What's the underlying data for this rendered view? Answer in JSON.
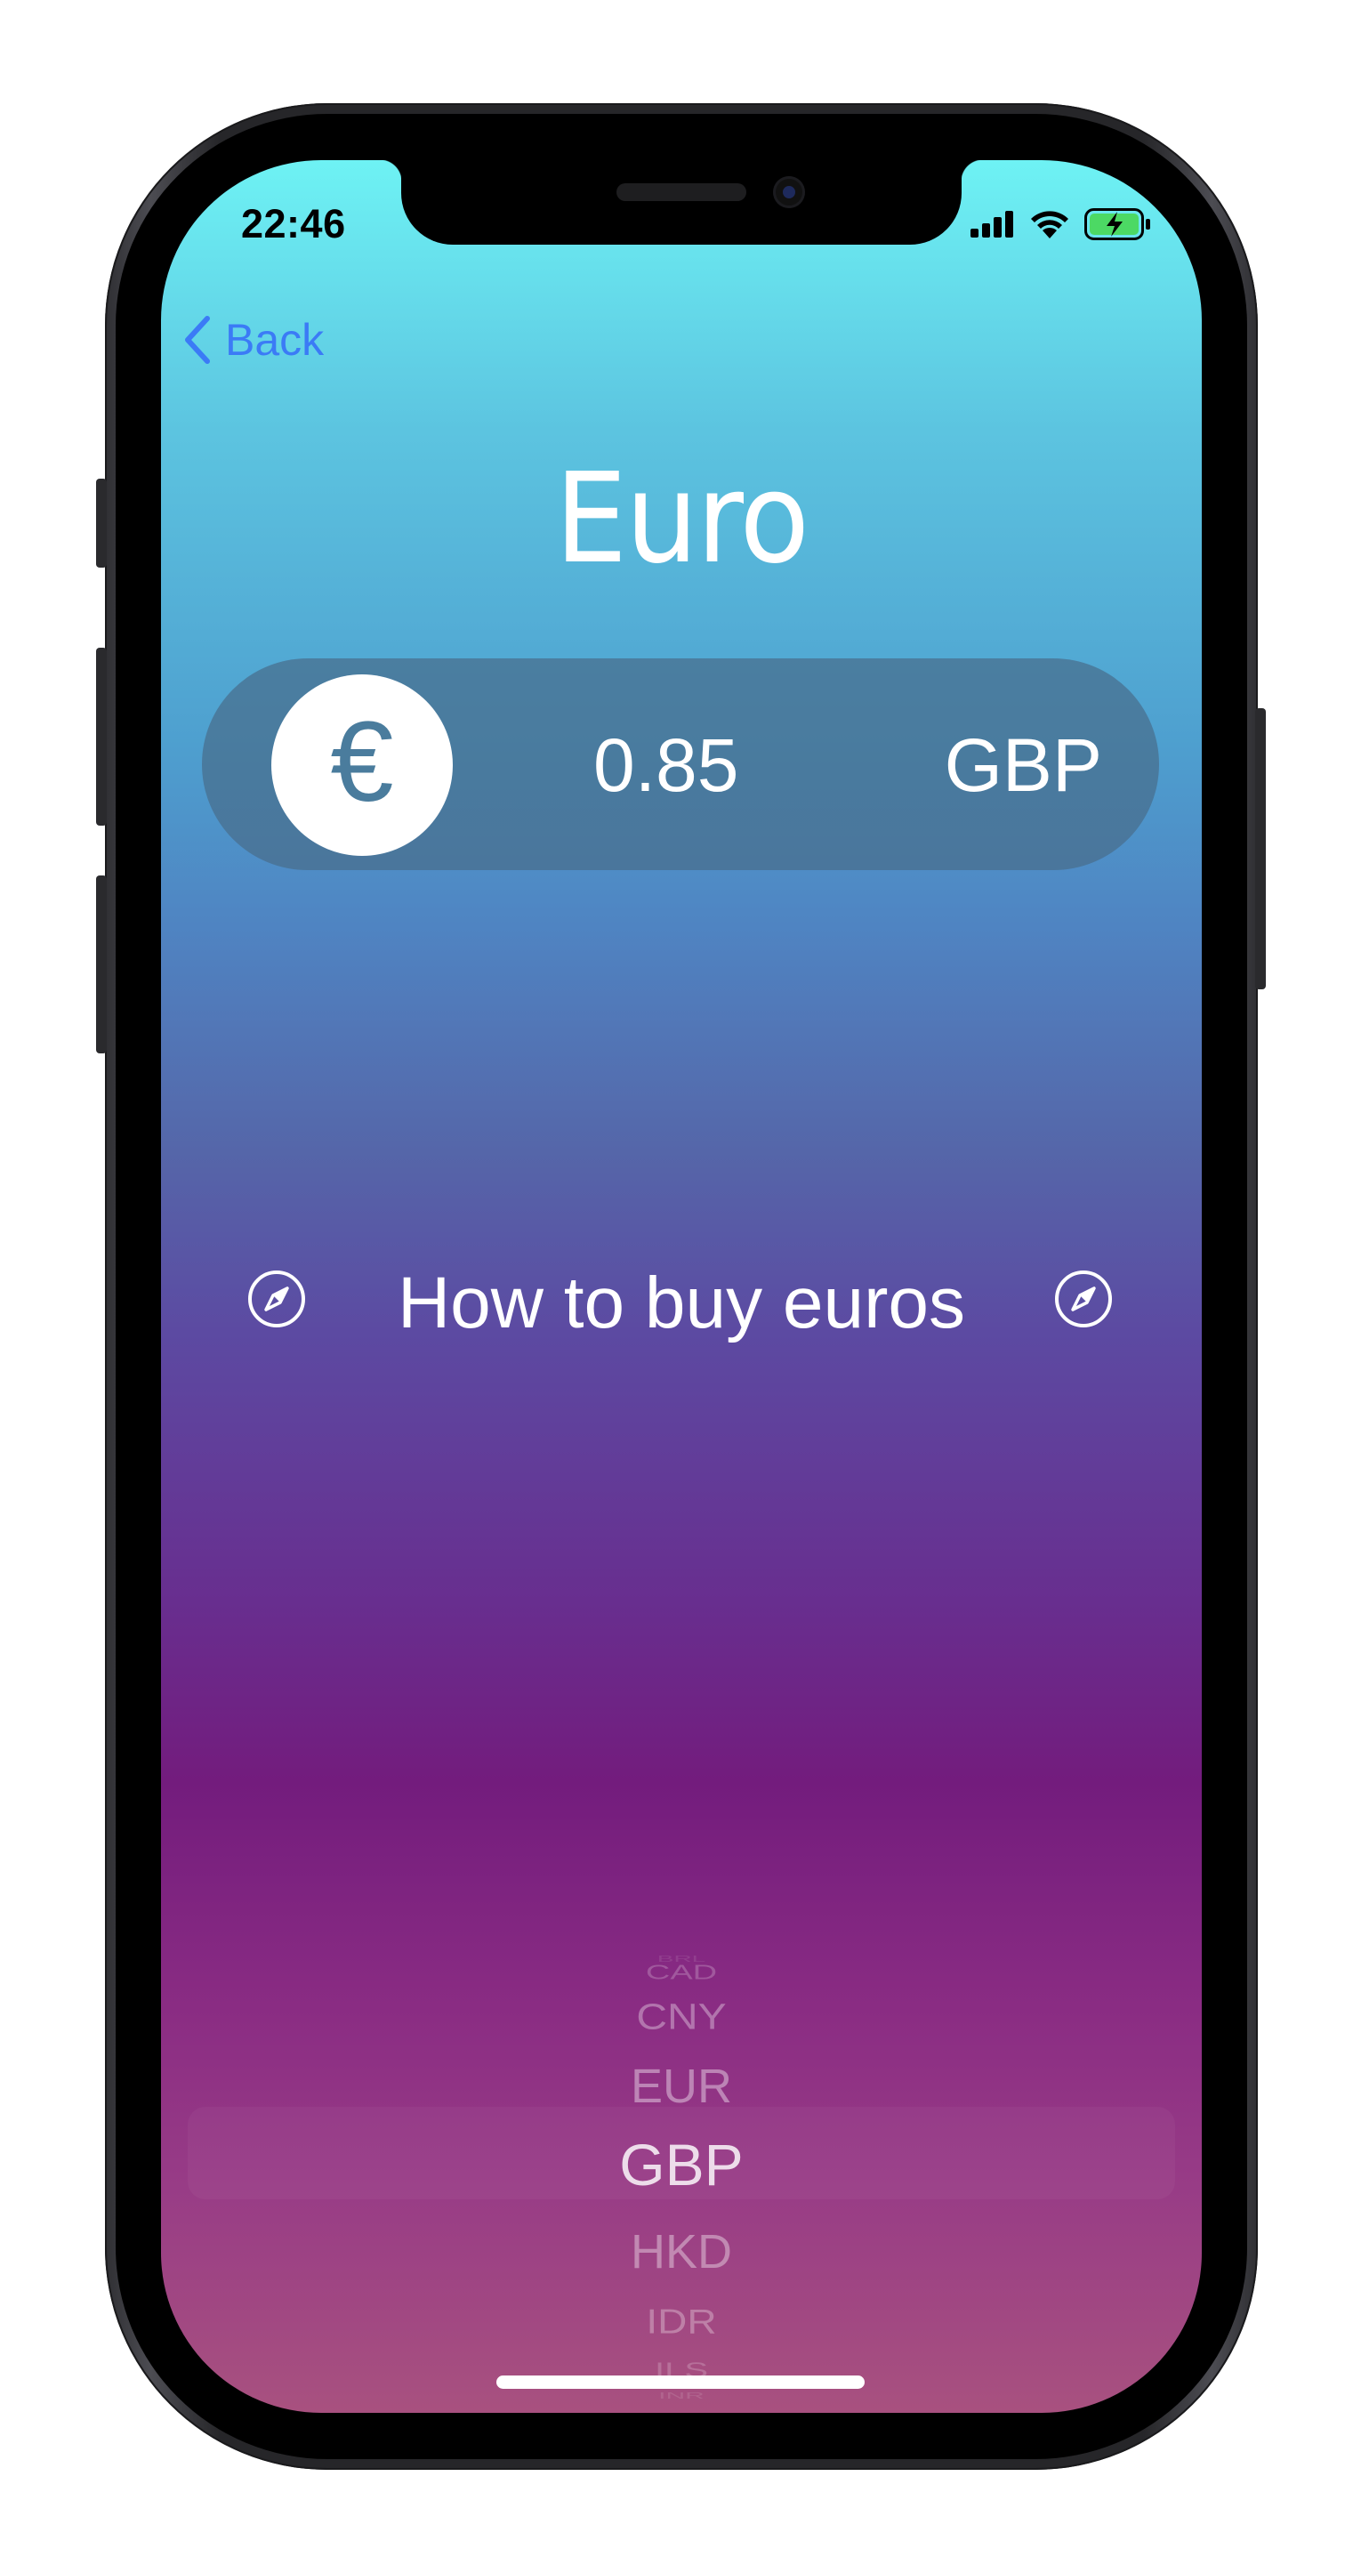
{
  "status_bar": {
    "time": "22:46",
    "icons": [
      "cellular-signal-icon",
      "wifi-icon",
      "battery-charging-icon"
    ]
  },
  "nav": {
    "back_label": "Back",
    "back_icon": "chevron-left-icon",
    "accent_color": "#3b7bf6"
  },
  "currency": {
    "name": "Euro",
    "symbol": "€",
    "rate": "0.85",
    "target_code": "GBP"
  },
  "buy_link": {
    "label": "How to buy euros",
    "icon": "compass-icon"
  },
  "picker": {
    "items": [
      "BRL",
      "CAD",
      "CNY",
      "EUR",
      "GBP",
      "HKD",
      "IDR",
      "ILS",
      "INR"
    ],
    "selected": "GBP"
  }
}
